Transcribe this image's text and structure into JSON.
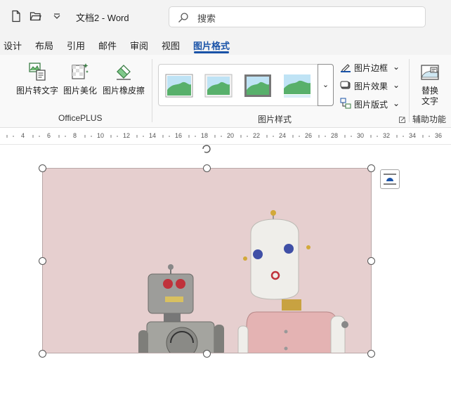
{
  "titlebar": {
    "doc_title": "文档2 - Word",
    "search_placeholder": "搜索",
    "icons": [
      "new-document-icon",
      "open-folder-icon",
      "customize-quick-access-icon",
      "search-icon"
    ]
  },
  "tabs": [
    {
      "label": "设计"
    },
    {
      "label": "布局"
    },
    {
      "label": "引用"
    },
    {
      "label": "邮件"
    },
    {
      "label": "审阅"
    },
    {
      "label": "视图"
    },
    {
      "label": "图片格式",
      "active": true
    }
  ],
  "ribbon": {
    "officeplus": {
      "group_label": "OfficePLUS",
      "buttons": [
        {
          "label": "图片转文字",
          "icon": "picture-to-text-icon"
        },
        {
          "label": "图片美化",
          "icon": "picture-beautify-icon"
        },
        {
          "label": "图片橡皮擦",
          "icon": "picture-eraser-icon"
        }
      ]
    },
    "picture_styles": {
      "group_label": "图片样式",
      "options": [
        {
          "label": "图片边框",
          "icon": "picture-border-icon"
        },
        {
          "label": "图片效果",
          "icon": "picture-effects-icon"
        },
        {
          "label": "图片版式",
          "icon": "picture-layout-icon"
        }
      ]
    },
    "accessibility": {
      "group_label": "辅助功能",
      "button_label_line1": "替换",
      "button_label_line2": "文字",
      "icon": "alt-text-icon"
    }
  },
  "ruler": {
    "ticks": [
      "4",
      "6",
      "8",
      "10",
      "12",
      "14",
      "16",
      "18",
      "20",
      "22",
      "24",
      "26",
      "28",
      "30",
      "32",
      "34",
      "36"
    ]
  },
  "colors": {
    "accent": "#1a53a8",
    "titlebar_bg": "#f3f3f3",
    "ribbon_bg": "#f9f9f9",
    "picture_bg": "#e4cccc"
  }
}
